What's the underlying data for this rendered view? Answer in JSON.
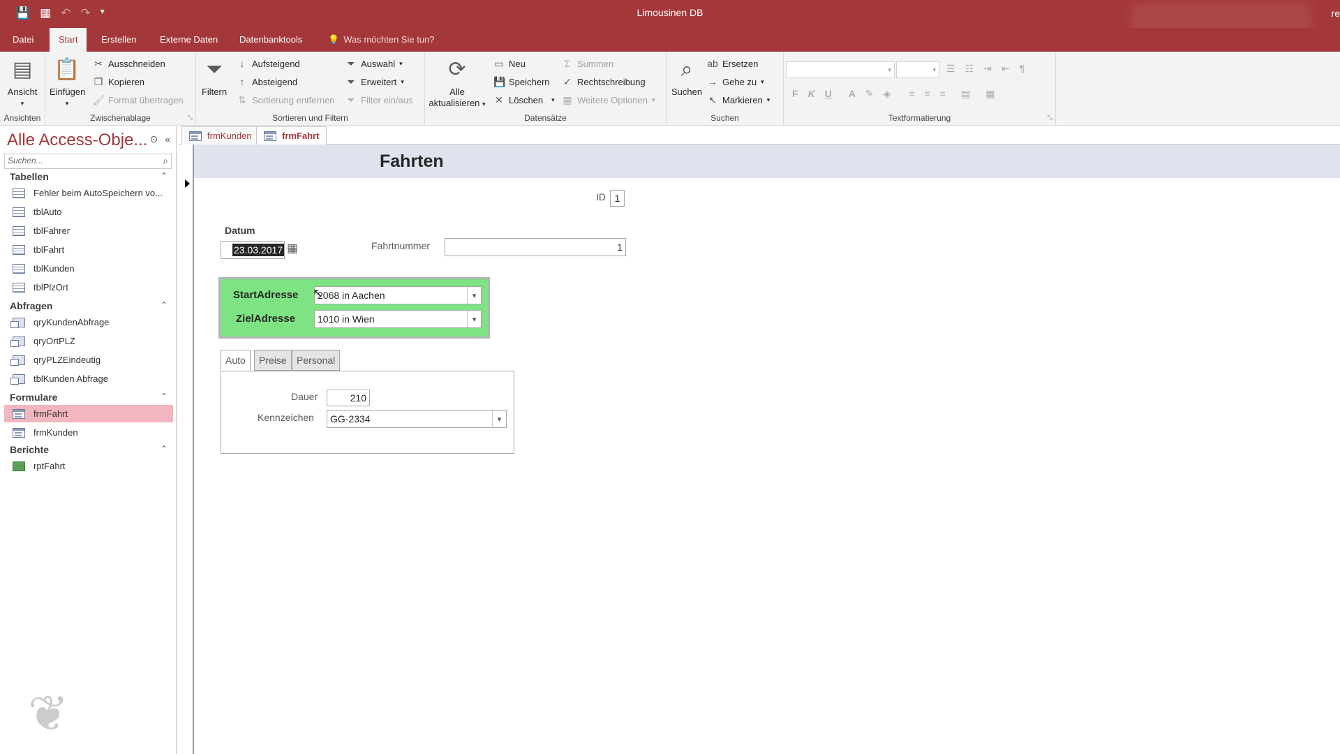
{
  "window": {
    "title": "Limousinen DB",
    "right_fragment": "re"
  },
  "ribbon_tabs": [
    "Datei",
    "Start",
    "Erstellen",
    "Externe Daten",
    "Datenbanktools"
  ],
  "tell_me": "Was möchten Sie tun?",
  "ribbon": {
    "ansichten": {
      "view": "Ansicht",
      "label": "Ansichten"
    },
    "zwischenablage": {
      "paste": "Einfügen",
      "cut": "Ausschneiden",
      "copy": "Kopieren",
      "format": "Format übertragen",
      "label": "Zwischenablage"
    },
    "sortieren": {
      "filter": "Filtern",
      "asc": "Aufsteigend",
      "desc": "Absteigend",
      "remove": "Sortierung entfernen",
      "selection": "Auswahl",
      "advanced": "Erweitert",
      "toggle": "Filter ein/aus",
      "label": "Sortieren und Filtern"
    },
    "datensaetze": {
      "refresh_1": "Alle",
      "refresh_2": "aktualisieren",
      "new": "Neu",
      "save": "Speichern",
      "delete": "Löschen",
      "totals": "Summen",
      "spelling": "Rechtschreibung",
      "more": "Weitere Optionen",
      "label": "Datensätze"
    },
    "suchen": {
      "find": "Suchen",
      "replace": "Ersetzen",
      "goto": "Gehe zu",
      "select": "Markieren",
      "label": "Suchen"
    },
    "text": {
      "bold": "F",
      "italic": "K",
      "underline": "U",
      "font_color": "A",
      "label": "Textformatierung"
    }
  },
  "nav": {
    "title": "Alle Access-Obje...",
    "search_placeholder": "Suchen...",
    "sections": {
      "tabellen": {
        "label": "Tabellen",
        "items": [
          "Fehler beim AutoSpeichern vo...",
          "tblAuto",
          "tblFahrer",
          "tblFahrt",
          "tblKunden",
          "tblPlzOrt"
        ]
      },
      "abfragen": {
        "label": "Abfragen",
        "items": [
          "qryKundenAbfrage",
          "qryOrtPLZ",
          "qryPLZEindeutig",
          "tblKunden Abfrage"
        ]
      },
      "formulare": {
        "label": "Formulare",
        "items": [
          "frmFahrt",
          "frmKunden"
        ]
      },
      "berichte": {
        "label": "Berichte",
        "items": [
          "rptFahrt"
        ]
      }
    }
  },
  "doc_tabs": [
    "frmKunden",
    "frmFahrt"
  ],
  "form": {
    "title": "Fahrten",
    "id_label": "ID",
    "id_value": "1",
    "datum_label": "Datum",
    "datum_value": "23.03.2017",
    "fahrtnummer_label": "Fahrtnummer",
    "fahrtnummer_value": "1",
    "start_label": "StartAdresse",
    "start_value": "2068 in Aachen",
    "ziel_label": "ZielAdresse",
    "ziel_value": "1010 in Wien",
    "tabs": [
      "Auto",
      "Preise",
      "Personal"
    ],
    "dauer_label": "Dauer",
    "dauer_value": "210",
    "kennzeichen_label": "Kennzeichen",
    "kennzeichen_value": "GG-2334"
  },
  "colors": {
    "accent": "#a4373a",
    "green_box": "#7de383",
    "form_header": "#dfe3ed",
    "nav_selected": "#f1b6c0"
  }
}
